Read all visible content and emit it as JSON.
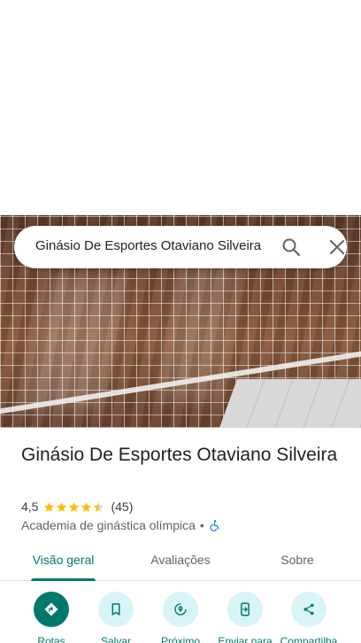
{
  "search": {
    "query": "Ginásio De Esportes Otaviano Silveira"
  },
  "place": {
    "title": "Ginásio De Esportes Otaviano Silveira",
    "rating": "4,5",
    "stars": 4.5,
    "review_count": "(45)",
    "category": "Academia de ginástica olímpica",
    "separator": "•"
  },
  "tabs": [
    {
      "label": "Visão geral",
      "active": true
    },
    {
      "label": "Avaliações",
      "active": false
    },
    {
      "label": "Sobre",
      "active": false
    }
  ],
  "actions": [
    {
      "label": "Rotas",
      "icon": "directions-icon"
    },
    {
      "label": "Salvar",
      "icon": "bookmark-icon"
    },
    {
      "label": "Próximo",
      "icon": "nearby-icon"
    },
    {
      "label": "Enviar para",
      "icon": "send-to-phone-icon"
    },
    {
      "label": "Compartilha",
      "icon": "share-icon"
    }
  ],
  "colors": {
    "accent": "#00796b",
    "star": "#fbbc04",
    "action_bg": "#d8f4f6"
  }
}
